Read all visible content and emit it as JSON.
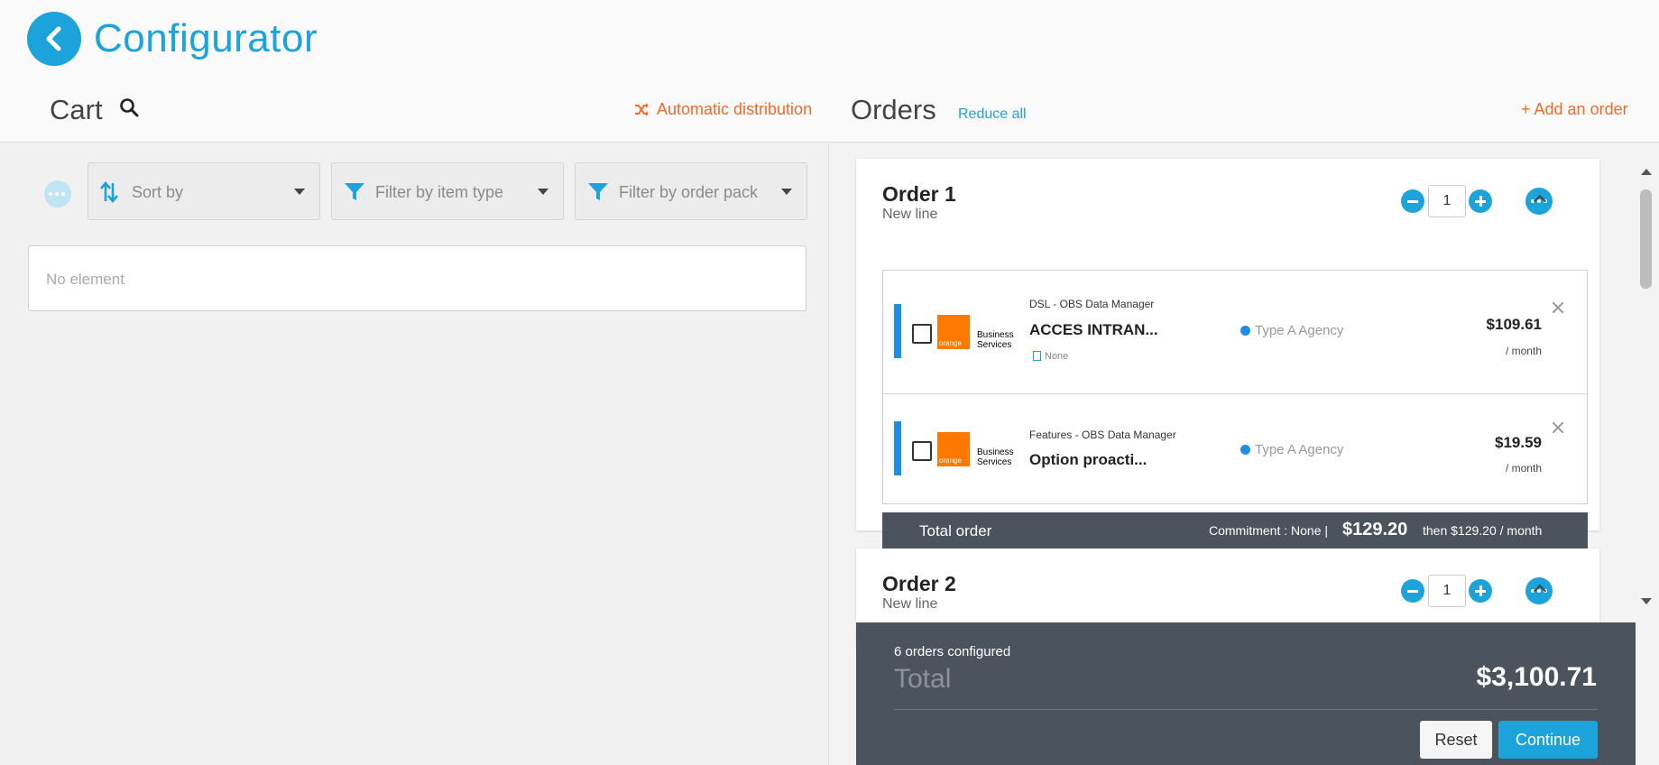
{
  "header": {
    "app_title": "Configurator",
    "back_icon": "chevron-left-icon"
  },
  "cart": {
    "title": "Cart",
    "search_icon": "search-icon",
    "more_icon": "more-horizontal-icon",
    "sort_placeholder": "Sort by",
    "filter_item_type_placeholder": "Filter by item type",
    "filter_order_pack_placeholder": "Filter by order pack",
    "empty_text": "No element"
  },
  "distribution": {
    "label": "Automatic distribution",
    "icon": "shuffle-icon"
  },
  "orders_header": {
    "title": "Orders",
    "reduce_all": "Reduce all",
    "add_order": "+ Add an order"
  },
  "orders": [
    {
      "title": "Order 1",
      "subtitle": "New line",
      "quantity": "1",
      "lines": [
        {
          "category": "DSL - OBS Data Manager",
          "product": "ACCES INTRAN...",
          "tag": "None",
          "agency": "Type A Agency",
          "price": "$109.61",
          "period": "/ month",
          "logo_text": "orange",
          "logo_sub1": "Business",
          "logo_sub2": "Services"
        },
        {
          "category": "Features - OBS Data Manager",
          "product": "Option proacti...",
          "agency": "Type A Agency",
          "price": "$19.59",
          "period": "/ month",
          "logo_text": "orange",
          "logo_sub1": "Business",
          "logo_sub2": "Services"
        }
      ],
      "total": {
        "label": "Total order",
        "commitment": "Commitment : None |",
        "amount": "$129.20",
        "then": "then $129.20 / month"
      }
    },
    {
      "title": "Order 2",
      "subtitle": "New line",
      "quantity": "1"
    }
  ],
  "summary": {
    "count": "6 orders configured",
    "total_label": "Total",
    "total_amount": "$3,100.71",
    "reset": "Reset",
    "continue": "Continue"
  },
  "colors": {
    "accent": "#1ca3dc",
    "action_orange": "#f06a2a",
    "summary_bg": "#4b535c",
    "brand_orange": "#ff7900"
  }
}
